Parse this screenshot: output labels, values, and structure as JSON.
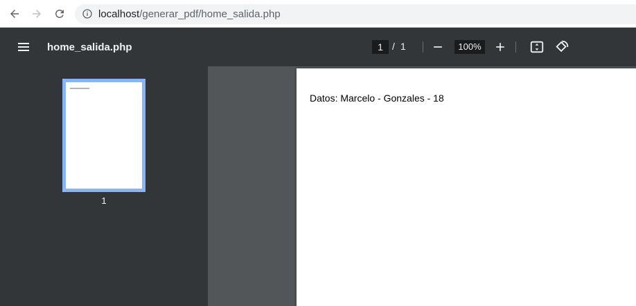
{
  "browser": {
    "url_host": "localhost",
    "url_path": "/generar_pdf/home_salida.php"
  },
  "toolbar": {
    "title": "home_salida.php",
    "current_page": "1",
    "page_separator": "/",
    "total_pages": "1",
    "zoom": "100%"
  },
  "sidebar": {
    "thumbnails": [
      {
        "label": "1"
      }
    ]
  },
  "document": {
    "text": "Datos: Marcelo - Gonzales - 18"
  },
  "colors": {
    "toolbar_bg": "#323639",
    "viewer_bg": "#525659",
    "thumb_highlight": "#8ab4f8"
  },
  "icons": [
    "back-arrow-icon",
    "forward-arrow-icon",
    "reload-icon",
    "info-icon",
    "menu-icon",
    "zoom-out-icon",
    "zoom-in-icon",
    "fit-page-icon",
    "rotate-icon"
  ]
}
